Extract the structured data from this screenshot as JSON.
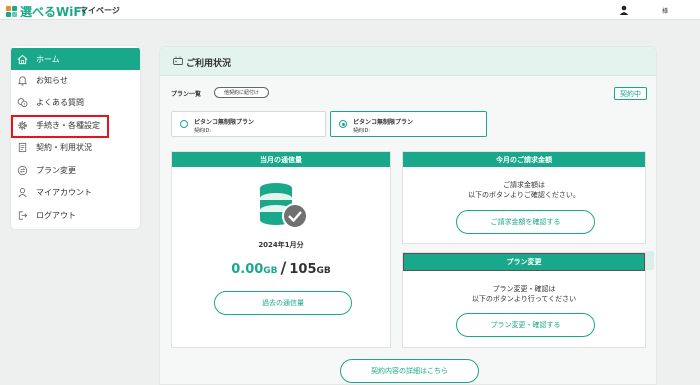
{
  "header": {
    "logo_text": "選べるWiFi",
    "mypage_label": "マイページ",
    "user_suffix": "様"
  },
  "sidebar": {
    "items": [
      {
        "label": "ホーム",
        "icon": "home-icon",
        "active": true
      },
      {
        "label": "お知らせ",
        "icon": "bell-icon"
      },
      {
        "label": "よくある質問",
        "icon": "faq-icon"
      },
      {
        "label": "手続き・各種設定",
        "icon": "gear-icon"
      },
      {
        "label": "契約・利用状況",
        "icon": "document-icon"
      },
      {
        "label": "プラン変更",
        "icon": "plan-change-icon"
      },
      {
        "label": "マイアカウント",
        "icon": "user-icon"
      },
      {
        "label": "ログアウト",
        "icon": "logout-icon"
      }
    ]
  },
  "main": {
    "title": "ご利用状況",
    "plan_list_label": "プラン一覧",
    "time_order_pill": "他契約に紐付け",
    "contract_badge": "契約中",
    "plans": [
      {
        "name": "ピタンコ無制限プラン",
        "id_label": "契約ID:"
      },
      {
        "name": "ピタンコ無制限プラン",
        "id_label": "契約ID:"
      }
    ],
    "usage_box": {
      "title": "当月の通信量",
      "date": "2024年1月分",
      "used": "0.00",
      "used_unit": "GB",
      "separator": "/",
      "total": "105",
      "total_unit": "GB",
      "button": "過去の通信量"
    },
    "billing_box": {
      "title": "今月のご請求金額",
      "line1": "ご請求金額は",
      "line2": "以下のボタンよりご確認ください。",
      "button": "ご請求金額を確認する"
    },
    "plan_change_box": {
      "title": "プラン変更",
      "line1": "プラン変更・確認は",
      "line2": "以下のボタンより行ってください",
      "button": "プラン変更・確認する"
    },
    "contract_details_button": "契約内容の詳細はこちら"
  },
  "colors": {
    "accent": "#1aa88b",
    "highlight": "#e8141b"
  }
}
